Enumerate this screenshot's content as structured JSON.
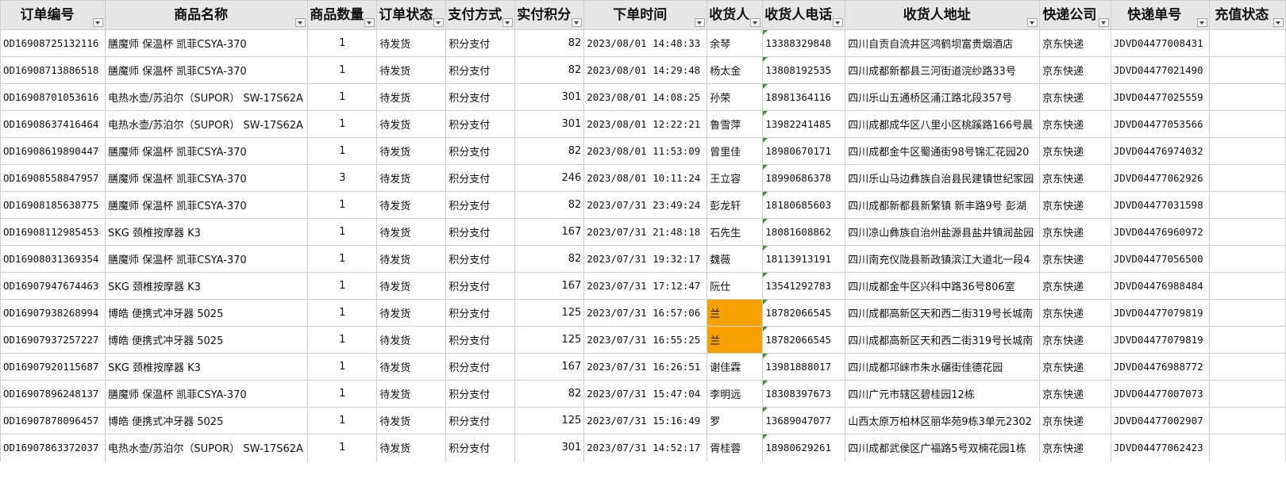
{
  "columns": [
    {
      "key": "order_id",
      "label": "订单编号"
    },
    {
      "key": "product",
      "label": "商品名称"
    },
    {
      "key": "qty",
      "label": "商品数量"
    },
    {
      "key": "status",
      "label": "订单状态"
    },
    {
      "key": "payment",
      "label": "支付方式"
    },
    {
      "key": "points",
      "label": "实付积分"
    },
    {
      "key": "time",
      "label": "下单时间"
    },
    {
      "key": "receiver",
      "label": "收货人"
    },
    {
      "key": "phone",
      "label": "收货人电话"
    },
    {
      "key": "address",
      "label": "收货人地址"
    },
    {
      "key": "courier",
      "label": "快递公司"
    },
    {
      "key": "tracking",
      "label": "快递单号"
    },
    {
      "key": "recharge",
      "label": "充值状态"
    }
  ],
  "rows": [
    {
      "order_id": "OD16908725132116",
      "product": "膳魔师 保温杯 凯菲CSYA-370",
      "qty": "1",
      "status": "待发货",
      "payment": "积分支付",
      "points": "82",
      "time": "2023/08/01 14:48:33",
      "receiver": "余琴",
      "phone": "13388329848",
      "address": "四川自贡自流井区鸿鹤坝富贵烟酒店",
      "courier": "京东快递",
      "tracking": "JDVD04477008431",
      "recharge": "",
      "highlight": false
    },
    {
      "order_id": "OD16908713886518",
      "product": "膳魔师 保温杯 凯菲CSYA-370",
      "qty": "1",
      "status": "待发货",
      "payment": "积分支付",
      "points": "82",
      "time": "2023/08/01 14:29:48",
      "receiver": "杨太金",
      "phone": "13808192535",
      "address": "四川成都新都县三河街道浣纱路33号",
      "courier": "京东快递",
      "tracking": "JDVD04477021490",
      "recharge": "",
      "highlight": false
    },
    {
      "order_id": "OD16908701053616",
      "product": "电热水壶/苏泊尔（SUPOR） SW-17S62A",
      "qty": "1",
      "status": "待发货",
      "payment": "积分支付",
      "points": "301",
      "time": "2023/08/01 14:08:25",
      "receiver": "孙荣",
      "phone": "18981364116",
      "address": "四川乐山五通桥区涌江路北段357号",
      "courier": "京东快递",
      "tracking": "JDVD04477025559",
      "recharge": "",
      "highlight": false
    },
    {
      "order_id": "OD16908637416464",
      "product": "电热水壶/苏泊尔（SUPOR） SW-17S62A",
      "qty": "1",
      "status": "待发货",
      "payment": "积分支付",
      "points": "301",
      "time": "2023/08/01 12:22:21",
      "receiver": "鲁雪萍",
      "phone": "13982241485",
      "address": "四川成都成华区八里小区桃蹊路166号晨",
      "courier": "京东快递",
      "tracking": "JDVD04477053566",
      "recharge": "",
      "highlight": false
    },
    {
      "order_id": "OD16908619890447",
      "product": "膳魔师 保温杯 凯菲CSYA-370",
      "qty": "1",
      "status": "待发货",
      "payment": "积分支付",
      "points": "82",
      "time": "2023/08/01 11:53:09",
      "receiver": "曾里佳",
      "phone": "18980670171",
      "address": "四川成都金牛区蜀通街98号锦汇花园20",
      "courier": "京东快递",
      "tracking": "JDVD04476974032",
      "recharge": "",
      "highlight": false
    },
    {
      "order_id": "OD16908558847957",
      "product": "膳魔师 保温杯 凯菲CSYA-370",
      "qty": "3",
      "status": "待发货",
      "payment": "积分支付",
      "points": "246",
      "time": "2023/08/01 10:11:24",
      "receiver": "王立容",
      "phone": "18990686378",
      "address": "四川乐山马边彝族自治县民建镇世纪家园",
      "courier": "京东快递",
      "tracking": "JDVD04477062926",
      "recharge": "",
      "highlight": false
    },
    {
      "order_id": "OD16908185638775",
      "product": "膳魔师 保温杯 凯菲CSYA-370",
      "qty": "1",
      "status": "待发货",
      "payment": "积分支付",
      "points": "82",
      "time": "2023/07/31 23:49:24",
      "receiver": "彭龙轩",
      "phone": "18180685603",
      "address": "四川成都新都县新繁镇 新丰路9号 彭湖",
      "courier": "京东快递",
      "tracking": "JDVD04477031598",
      "recharge": "",
      "highlight": false
    },
    {
      "order_id": "OD16908112985453",
      "product": "SKG 颈椎按摩器 K3",
      "qty": "1",
      "status": "待发货",
      "payment": "积分支付",
      "points": "167",
      "time": "2023/07/31 21:48:18",
      "receiver": "石先生",
      "phone": "18081608862",
      "address": "四川凉山彝族自治州盐源县盐井镇润盐园",
      "courier": "京东快递",
      "tracking": "JDVD04476960972",
      "recharge": "",
      "highlight": false
    },
    {
      "order_id": "OD16908031369354",
      "product": "膳魔师 保温杯 凯菲CSYA-370",
      "qty": "1",
      "status": "待发货",
      "payment": "积分支付",
      "points": "82",
      "time": "2023/07/31 19:32:17",
      "receiver": "魏薇",
      "phone": "18113913191",
      "address": "四川南充仪陇县新政镇滨江大道北一段4",
      "courier": "京东快递",
      "tracking": "JDVD04477056500",
      "recharge": "",
      "highlight": false
    },
    {
      "order_id": "OD16907947674463",
      "product": "SKG 颈椎按摩器 K3",
      "qty": "1",
      "status": "待发货",
      "payment": "积分支付",
      "points": "167",
      "time": "2023/07/31 17:12:47",
      "receiver": "阮仕",
      "phone": "13541292783",
      "address": "四川成都金牛区兴科中路36号806室",
      "courier": "京东快递",
      "tracking": "JDVD04476988484",
      "recharge": "",
      "highlight": false
    },
    {
      "order_id": "OD16907938268994",
      "product": "博皓 便携式冲牙器 5025",
      "qty": "1",
      "status": "待发货",
      "payment": "积分支付",
      "points": "125",
      "time": "2023/07/31 16:57:06",
      "receiver": "兰",
      "phone": "18782066545",
      "address": "四川成都高新区天和西二街319号长城南",
      "courier": "京东快递",
      "tracking": "JDVD04477079819",
      "recharge": "",
      "highlight": true
    },
    {
      "order_id": "OD16907937257227",
      "product": "博皓 便携式冲牙器 5025",
      "qty": "1",
      "status": "待发货",
      "payment": "积分支付",
      "points": "125",
      "time": "2023/07/31 16:55:25",
      "receiver": "兰",
      "phone": "18782066545",
      "address": "四川成都高新区天和西二街319号长城南",
      "courier": "京东快递",
      "tracking": "JDVD04477079819",
      "recharge": "",
      "highlight": true
    },
    {
      "order_id": "OD16907920115687",
      "product": "SKG 颈椎按摩器 K3",
      "qty": "1",
      "status": "待发货",
      "payment": "积分支付",
      "points": "167",
      "time": "2023/07/31 16:26:51",
      "receiver": "谢佳霖",
      "phone": "13981888017",
      "address": "四川成都邛崃市朱水碾街佳德花园",
      "courier": "京东快递",
      "tracking": "JDVD04476988772",
      "recharge": "",
      "highlight": false
    },
    {
      "order_id": "OD16907896248137",
      "product": "膳魔师 保温杯 凯菲CSYA-370",
      "qty": "1",
      "status": "待发货",
      "payment": "积分支付",
      "points": "82",
      "time": "2023/07/31 15:47:04",
      "receiver": "李明远",
      "phone": "18308397673",
      "address": "四川广元市辖区碧桂园12栋",
      "courier": "京东快递",
      "tracking": "JDVD04477007073",
      "recharge": "",
      "highlight": false
    },
    {
      "order_id": "OD16907878096457",
      "product": "博皓 便携式冲牙器 5025",
      "qty": "1",
      "status": "待发货",
      "payment": "积分支付",
      "points": "125",
      "time": "2023/07/31 15:16:49",
      "receiver": "罗",
      "phone": "13689047077",
      "address": "山西太原万柏林区丽华苑9栋3单元2302",
      "courier": "京东快递",
      "tracking": "JDVD04477002907",
      "recharge": "",
      "highlight": false
    },
    {
      "order_id": "OD16907863372037",
      "product": "电热水壶/苏泊尔（SUPOR） SW-17S62A",
      "qty": "1",
      "status": "待发货",
      "payment": "积分支付",
      "points": "301",
      "time": "2023/07/31 14:52:17",
      "receiver": "胥桂蓉",
      "phone": "18980629261",
      "address": "四川成都武侯区广福路5号双楠花园1栋",
      "courier": "京东快递",
      "tracking": "JDVD04477062423",
      "recharge": "",
      "highlight": false
    }
  ],
  "colors": {
    "highlight": "#f7a100",
    "header_bg": "#e6e6e6",
    "grid": "#cfcfcf",
    "comment_flag": "#2e9a2e"
  }
}
